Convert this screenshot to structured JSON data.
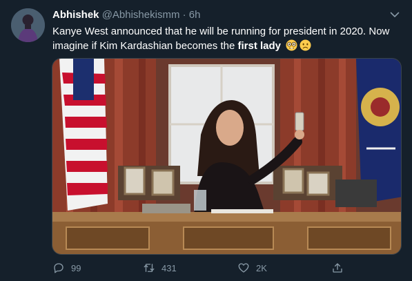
{
  "tweet": {
    "author_name": "Abhishek",
    "author_handle": "@Abhishekismm",
    "separator": "·",
    "timestamp": "6h",
    "text_part1": "Kanye West announced that he will be running for president in 2020. Now imagine if Kim Kardashian becomes the ",
    "text_bold": "first lady",
    "emojis": [
      "nerd-face-emoji",
      "frowning-face-emoji"
    ],
    "media_alt": "photo"
  },
  "actions": {
    "reply_count": "99",
    "retweet_count": "431",
    "like_count": "2K",
    "share_label": ""
  },
  "colors": {
    "background": "#15202b",
    "secondary_text": "#8899a6",
    "border": "#38444d"
  }
}
